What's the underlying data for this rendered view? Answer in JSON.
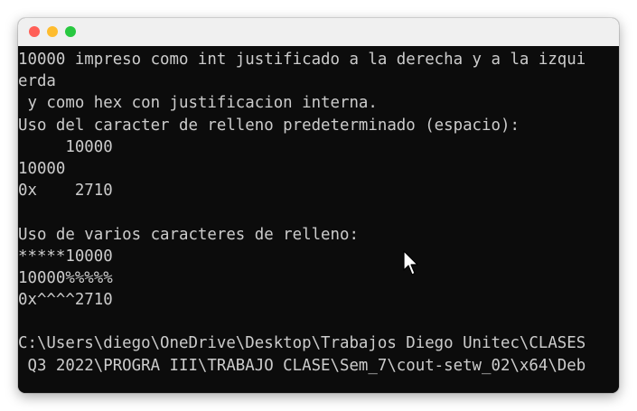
{
  "window": {
    "controls": {
      "close_color": "#ff5f57",
      "minimize_color": "#febc2e",
      "maximize_color": "#28c840"
    }
  },
  "terminal": {
    "background": "#0c0c0c",
    "foreground": "#cccccc",
    "lines": [
      "10000 impreso como int justificado a la derecha y a la izqui",
      "erda",
      " y como hex con justificacion interna.",
      "Uso del caracter de relleno predeterminado (espacio):",
      "     10000",
      "10000",
      "0x    2710",
      "",
      "Uso de varios caracteres de relleno:",
      "*****10000",
      "10000%%%%%",
      "0x^^^^2710",
      "",
      "C:\\Users\\diego\\OneDrive\\Desktop\\Trabajos Diego Unitec\\CLASES",
      " Q3 2022\\PROGRA III\\TRABAJO CLASE\\Sem_7\\cout-setw_02\\x64\\Deb"
    ]
  },
  "mouse_pointer": {
    "icon": "arrow-cursor-icon"
  }
}
